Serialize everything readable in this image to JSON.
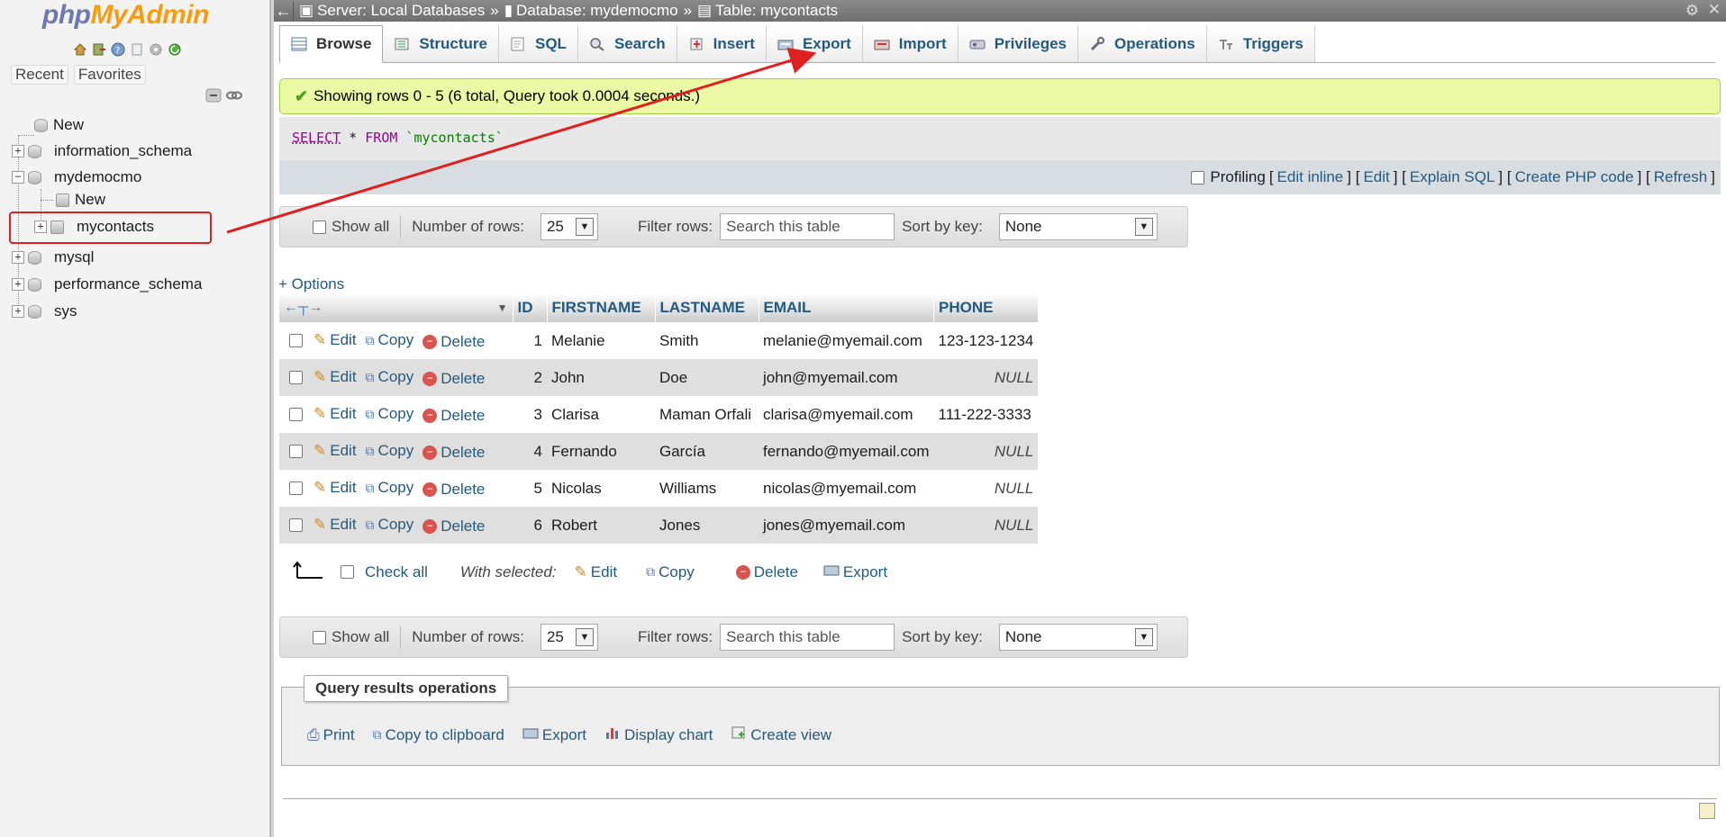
{
  "nav": {
    "logo_php": "php",
    "logo_ma": "MyAdmin",
    "icons": [
      "home-icon",
      "exit-icon",
      "help-icon",
      "docs-icon",
      "settings-icon",
      "reload-icon"
    ],
    "recent": "Recent",
    "favorites": "Favorites",
    "tree": [
      {
        "label": "New",
        "level": 0
      },
      {
        "label": "information_schema",
        "level": 0
      },
      {
        "label": "mydemocmo",
        "level": 0
      },
      {
        "label": "New",
        "level": 1
      },
      {
        "label": "mycontacts",
        "level": 1
      },
      {
        "label": "mysql",
        "level": 0
      },
      {
        "label": "performance_schema",
        "level": 0
      },
      {
        "label": "sys",
        "level": 0
      }
    ]
  },
  "breadcrumb": {
    "server": "Server: Local Databases",
    "database": "Database: mydemocmo",
    "table": "Table: mycontacts"
  },
  "tabs": [
    "Browse",
    "Structure",
    "SQL",
    "Search",
    "Insert",
    "Export",
    "Import",
    "Privileges",
    "Operations",
    "Triggers"
  ],
  "message": "Showing rows 0 - 5 (6 total, Query took 0.0004 seconds.)",
  "sql": {
    "kw1": "SELECT",
    "star": " * ",
    "kw2": "FROM",
    "table": " `mycontacts`"
  },
  "sql_tools": {
    "profiling": "Profiling",
    "links": [
      "Edit inline",
      "Edit",
      "Explain SQL",
      "Create PHP code",
      "Refresh"
    ]
  },
  "navbar": {
    "show_all": "Show all",
    "num_rows_label": "Number of rows:",
    "num_rows": "25",
    "filter_label": "Filter rows:",
    "filter_placeholder": "Search this table",
    "sort_label": "Sort by key:",
    "sort_value": "None"
  },
  "options": "+ Options",
  "columns": [
    "ID",
    "FIRSTNAME",
    "LASTNAME",
    "EMAIL",
    "PHONE"
  ],
  "row_actions": {
    "edit": "Edit",
    "copy": "Copy",
    "delete": "Delete"
  },
  "rows": [
    {
      "id": "1",
      "first": "Melanie",
      "last": "Smith",
      "email": "melanie@myemail.com",
      "phone": "123-123-1234"
    },
    {
      "id": "2",
      "first": "John",
      "last": "Doe",
      "email": "john@myemail.com",
      "phone": "NULL"
    },
    {
      "id": "3",
      "first": "Clarisa",
      "last": "Maman Orfali",
      "email": "clarisa@myemail.com",
      "phone": "111-222-3333"
    },
    {
      "id": "4",
      "first": "Fernando",
      "last": "García",
      "email": "fernando@myemail.com",
      "phone": "NULL"
    },
    {
      "id": "5",
      "first": "Nicolas",
      "last": "Williams",
      "email": "nicolas@myemail.com",
      "phone": "NULL"
    },
    {
      "id": "6",
      "first": "Robert",
      "last": "Jones",
      "email": "jones@myemail.com",
      "phone": "NULL"
    }
  ],
  "bulk": {
    "check_all": "Check all",
    "with_selected": "With selected:",
    "edit": "Edit",
    "copy": "Copy",
    "delete": "Delete",
    "export": "Export"
  },
  "qro": {
    "title": "Query results operations",
    "links": [
      "Print",
      "Copy to clipboard",
      "Export",
      "Display chart",
      "Create view"
    ]
  },
  "colors": {
    "link": "#235a81",
    "success_bg": "#ebf8a4",
    "annotation": "#e02020"
  }
}
